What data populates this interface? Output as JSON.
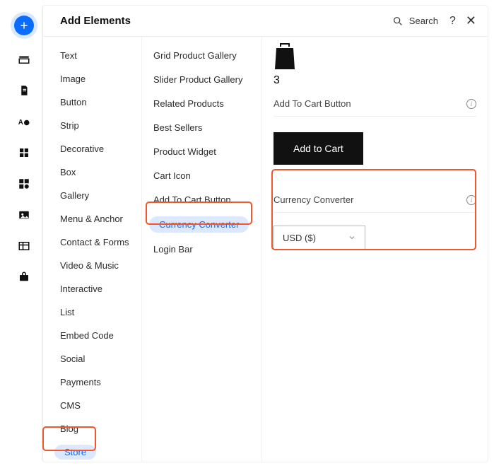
{
  "header": {
    "title": "Add Elements",
    "search_label": "Search",
    "help_label": "?",
    "close_label": "✕"
  },
  "col1": {
    "items": [
      "Text",
      "Image",
      "Button",
      "Strip",
      "Decorative",
      "Box",
      "Gallery",
      "Menu & Anchor",
      "Contact & Forms",
      "Video & Music",
      "Interactive",
      "List",
      "Embed Code",
      "Social",
      "Payments",
      "CMS",
      "Blog",
      "Store"
    ],
    "selected_index": 17
  },
  "col2": {
    "items": [
      "Grid Product Gallery",
      "Slider Product Gallery",
      "Related Products",
      "Best Sellers",
      "Product Widget",
      "Cart Icon",
      "Add To Cart Button",
      "Currency Converter",
      "Login Bar"
    ],
    "selected_index": 7
  },
  "preview": {
    "bag_count": "3",
    "add_to_cart_label": "Add To Cart Button",
    "add_to_cart_button": "Add to Cart",
    "currency_converter_label": "Currency Converter",
    "currency_value": "USD ($)"
  }
}
